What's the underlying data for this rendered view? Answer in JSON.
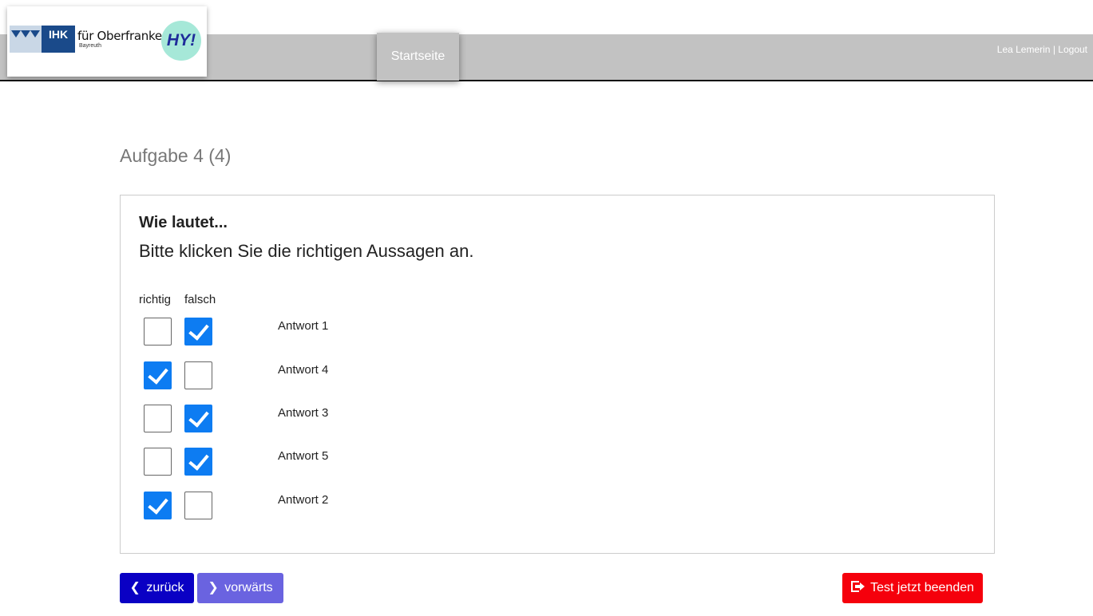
{
  "header": {
    "logo": {
      "ihk_text": "IHK",
      "org_text": "für Oberfranken",
      "city_text": "Bayreuth",
      "badge_text": "HY!"
    },
    "nav_home": "Startseite",
    "user_name": "Lea Lemerin",
    "separator": "|",
    "logout": "Logout"
  },
  "task": {
    "title": "Aufgabe 4 (4)",
    "question_title": "Wie lautet...",
    "question_text": "Bitte klicken Sie die richtigen Aussagen an.",
    "col_correct": "richtig",
    "col_wrong": "falsch",
    "answers": [
      {
        "label": "Antwort 1",
        "richtig": false,
        "falsch": true
      },
      {
        "label": "Antwort 4",
        "richtig": true,
        "falsch": false
      },
      {
        "label": "Antwort 3",
        "richtig": false,
        "falsch": true
      },
      {
        "label": "Antwort 5",
        "richtig": false,
        "falsch": true
      },
      {
        "label": "Antwort 2",
        "richtig": true,
        "falsch": false
      }
    ]
  },
  "buttons": {
    "back": "zurück",
    "forward": "vorwärts",
    "end_test": "Test jetzt beenden"
  },
  "colors": {
    "checkbox_checked": "#0d7cf2",
    "back_button": "#0a00c4",
    "forward_button": "#6a63e0",
    "end_button": "#f5000c",
    "header_bar": "#c2c2c2"
  }
}
